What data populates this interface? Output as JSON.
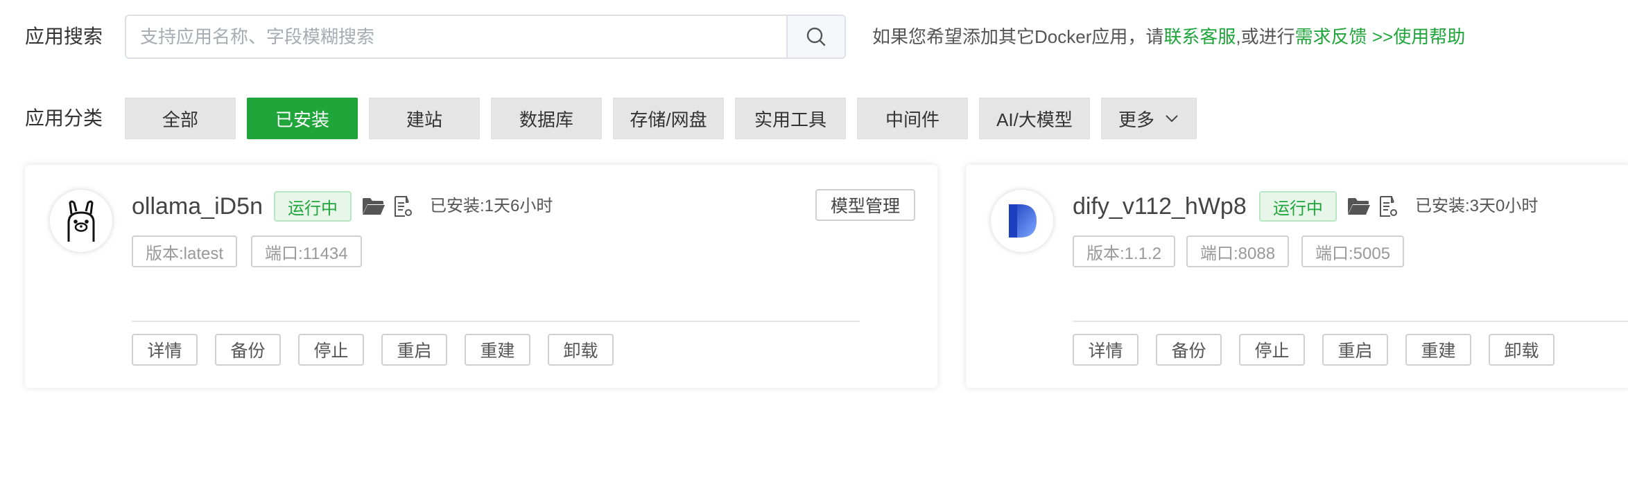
{
  "search": {
    "label": "应用搜索",
    "placeholder": "支持应用名称、字段模糊搜索",
    "value": "",
    "help_prefix": "如果您希望添加其它Docker应用，请",
    "help_contact": "联系客服",
    "help_middle": ",或进行",
    "help_feedback": "需求反馈",
    "help_usage": " >>使用帮助"
  },
  "categories": {
    "label": "应用分类",
    "items": [
      "全部",
      "已安装",
      "建站",
      "数据库",
      "存储/网盘",
      "实用工具",
      "中间件",
      "AI/大模型",
      "更多"
    ],
    "active_index": 1
  },
  "colors": {
    "accent": "#20a53a",
    "category_bg": "#e5e5e5"
  },
  "apps": [
    {
      "name": "ollama_iD5n",
      "icon": "llama-icon",
      "status": "运行中",
      "installed": "已安装:1天6小时",
      "tags": [
        "版本:latest",
        "端口:11434"
      ],
      "extra_button": "模型管理",
      "actions": [
        "详情",
        "备份",
        "停止",
        "重启",
        "重建",
        "卸载"
      ]
    },
    {
      "name": "dify_v112_hWp8",
      "icon": "dify-icon",
      "status": "运行中",
      "installed": "已安装:3天0小时",
      "tags": [
        "版本:1.1.2",
        "端口:8088",
        "端口:5005"
      ],
      "actions": [
        "详情",
        "备份",
        "停止",
        "重启",
        "重建",
        "卸载"
      ]
    }
  ]
}
